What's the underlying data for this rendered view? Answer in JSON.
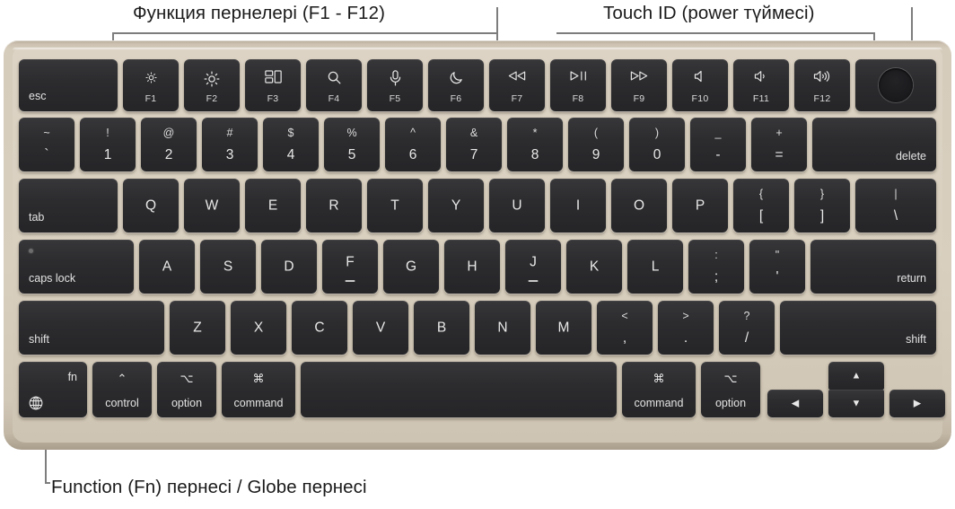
{
  "annotations": {
    "function_row": "Функция пернелері (F1 - F12)",
    "touch_id": "Touch ID (power түймесі)",
    "globe_key": "Function (Fn) пернесі / Globe пернесі"
  },
  "colors": {
    "chassis": "#d8cfbf",
    "deck": "#dcd3c4",
    "key": "#2c2c2f",
    "key_text": "#e8e8e8",
    "leader_line": "#7d7d7d",
    "annotation_text": "#1a1a1a",
    "page_background": "#ffffff"
  },
  "keyboard": {
    "layout": "Apple MacBook Air Magic Keyboard, US English, with Touch ID",
    "rows": [
      {
        "name": "function-row",
        "keys": [
          {
            "name": "esc",
            "label": "esc"
          },
          {
            "name": "f1",
            "icon": "brightness-down-icon",
            "label": "F1"
          },
          {
            "name": "f2",
            "icon": "brightness-up-icon",
            "label": "F2"
          },
          {
            "name": "f3",
            "icon": "mission-control-icon",
            "label": "F3"
          },
          {
            "name": "f4",
            "icon": "spotlight-search-icon",
            "label": "F4"
          },
          {
            "name": "f5",
            "icon": "dictation-mic-icon",
            "label": "F5"
          },
          {
            "name": "f6",
            "icon": "do-not-disturb-moon-icon",
            "label": "F6"
          },
          {
            "name": "f7",
            "icon": "rewind-icon",
            "label": "F7"
          },
          {
            "name": "f8",
            "icon": "play-pause-icon",
            "label": "F8"
          },
          {
            "name": "f9",
            "icon": "fast-forward-icon",
            "label": "F9"
          },
          {
            "name": "f10",
            "icon": "mute-icon",
            "label": "F10"
          },
          {
            "name": "f11",
            "icon": "volume-down-icon",
            "label": "F11"
          },
          {
            "name": "f12",
            "icon": "volume-up-icon",
            "label": "F12"
          },
          {
            "name": "touch-id",
            "icon": "touch-id-power-icon",
            "label": ""
          }
        ]
      },
      {
        "name": "number-row",
        "keys": [
          {
            "name": "grave",
            "top": "~",
            "bottom": "`"
          },
          {
            "name": "one",
            "top": "!",
            "bottom": "1"
          },
          {
            "name": "two",
            "top": "@",
            "bottom": "2"
          },
          {
            "name": "three",
            "top": "#",
            "bottom": "3"
          },
          {
            "name": "four",
            "top": "$",
            "bottom": "4"
          },
          {
            "name": "five",
            "top": "%",
            "bottom": "5"
          },
          {
            "name": "six",
            "top": "^",
            "bottom": "6"
          },
          {
            "name": "seven",
            "top": "&",
            "bottom": "7"
          },
          {
            "name": "eight",
            "top": "*",
            "bottom": "8"
          },
          {
            "name": "nine",
            "top": "(",
            "bottom": "9"
          },
          {
            "name": "zero",
            "top": ")",
            "bottom": "0"
          },
          {
            "name": "minus",
            "top": "_",
            "bottom": "-"
          },
          {
            "name": "equal",
            "top": "+",
            "bottom": "="
          },
          {
            "name": "delete",
            "label": "delete"
          }
        ]
      },
      {
        "name": "top-letter-row",
        "keys": [
          {
            "name": "tab",
            "label": "tab"
          },
          {
            "name": "q",
            "label": "Q"
          },
          {
            "name": "w",
            "label": "W"
          },
          {
            "name": "e",
            "label": "E"
          },
          {
            "name": "r",
            "label": "R"
          },
          {
            "name": "t",
            "label": "T"
          },
          {
            "name": "y",
            "label": "Y"
          },
          {
            "name": "u",
            "label": "U"
          },
          {
            "name": "i",
            "label": "I"
          },
          {
            "name": "o",
            "label": "O"
          },
          {
            "name": "p",
            "label": "P"
          },
          {
            "name": "bracket-left",
            "top": "{",
            "bottom": "["
          },
          {
            "name": "bracket-right",
            "top": "}",
            "bottom": "]"
          },
          {
            "name": "backslash",
            "top": "|",
            "bottom": "\\"
          }
        ]
      },
      {
        "name": "home-row",
        "keys": [
          {
            "name": "caps-lock",
            "label": "caps lock"
          },
          {
            "name": "a",
            "label": "A"
          },
          {
            "name": "s",
            "label": "S"
          },
          {
            "name": "d",
            "label": "D"
          },
          {
            "name": "f",
            "label": "F",
            "homing_bump": true
          },
          {
            "name": "g",
            "label": "G"
          },
          {
            "name": "h",
            "label": "H"
          },
          {
            "name": "j",
            "label": "J",
            "homing_bump": true
          },
          {
            "name": "k",
            "label": "K"
          },
          {
            "name": "l",
            "label": "L"
          },
          {
            "name": "semicolon",
            "top": ":",
            "bottom": ";"
          },
          {
            "name": "quote",
            "top": "\"",
            "bottom": "'"
          },
          {
            "name": "return",
            "label": "return"
          }
        ]
      },
      {
        "name": "shift-row",
        "keys": [
          {
            "name": "shift-left",
            "label": "shift"
          },
          {
            "name": "z",
            "label": "Z"
          },
          {
            "name": "x",
            "label": "X"
          },
          {
            "name": "c",
            "label": "C"
          },
          {
            "name": "v",
            "label": "V"
          },
          {
            "name": "b",
            "label": "B"
          },
          {
            "name": "n",
            "label": "N"
          },
          {
            "name": "m",
            "label": "M"
          },
          {
            "name": "comma",
            "top": "<",
            "bottom": ","
          },
          {
            "name": "period",
            "top": ">",
            "bottom": "."
          },
          {
            "name": "slash",
            "top": "?",
            "bottom": "/"
          },
          {
            "name": "shift-right",
            "label": "shift"
          }
        ]
      },
      {
        "name": "bottom-row",
        "keys": [
          {
            "name": "fn-globe",
            "label": "fn",
            "icon": "globe-icon"
          },
          {
            "name": "control",
            "label": "control",
            "symbol": "⌃"
          },
          {
            "name": "option-left",
            "label": "option",
            "symbol": "⌥"
          },
          {
            "name": "command-left",
            "label": "command",
            "symbol": "⌘"
          },
          {
            "name": "space",
            "label": ""
          },
          {
            "name": "command-right",
            "label": "command",
            "symbol": "⌘"
          },
          {
            "name": "option-right",
            "label": "option",
            "symbol": "⌥"
          },
          {
            "name": "arrow-left",
            "icon": "arrow-left-icon"
          },
          {
            "name": "arrow-up",
            "icon": "arrow-up-icon"
          },
          {
            "name": "arrow-down",
            "icon": "arrow-down-icon"
          },
          {
            "name": "arrow-right",
            "icon": "arrow-right-icon"
          }
        ]
      }
    ]
  }
}
